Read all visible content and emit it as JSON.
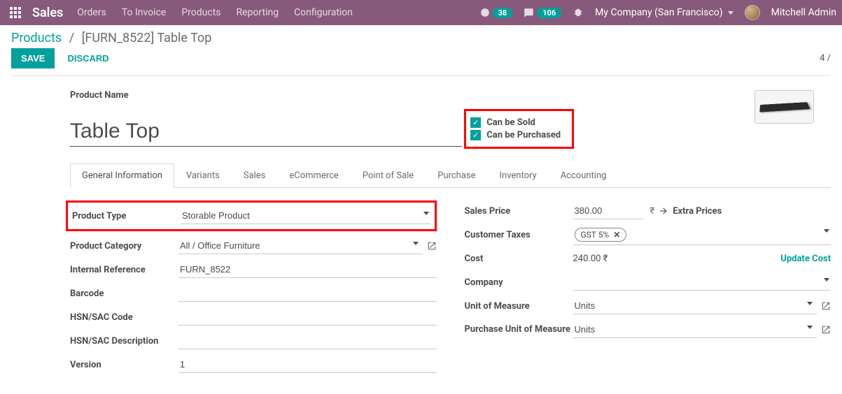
{
  "navbar": {
    "brand": "Sales",
    "menu": [
      "Orders",
      "To Invoice",
      "Products",
      "Reporting",
      "Configuration"
    ],
    "activity_count": "38",
    "message_count": "106",
    "company": "My Company (San Francisco)",
    "user": "Mitchell Admin"
  },
  "breadcrumb": {
    "root": "Products",
    "current": "[FURN_8522] Table Top"
  },
  "actions": {
    "save": "SAVE",
    "discard": "DISCARD",
    "pager": "4 /"
  },
  "product": {
    "name_label": "Product Name",
    "name": "Table Top",
    "can_be_sold": "Can be Sold",
    "can_be_purchased": "Can be Purchased"
  },
  "tabs": [
    "General Information",
    "Variants",
    "Sales",
    "eCommerce",
    "Point of Sale",
    "Purchase",
    "Inventory",
    "Accounting"
  ],
  "left_fields": {
    "product_type": {
      "label": "Product Type",
      "value": "Storable Product"
    },
    "category": {
      "label": "Product Category",
      "value": "All / Office Furniture"
    },
    "internal_ref": {
      "label": "Internal Reference",
      "value": "FURN_8522"
    },
    "barcode": {
      "label": "Barcode",
      "value": ""
    },
    "hsn_code": {
      "label": "HSN/SAC Code",
      "value": ""
    },
    "hsn_desc": {
      "label": "HSN/SAC Description",
      "value": ""
    },
    "version": {
      "label": "Version",
      "value": "1"
    }
  },
  "right_fields": {
    "sales_price": {
      "label": "Sales Price",
      "value": "380.00",
      "currency": "₹",
      "extra": "Extra Prices"
    },
    "customer_taxes": {
      "label": "Customer Taxes",
      "tag": "GST 5%"
    },
    "cost": {
      "label": "Cost",
      "value": "240.00 ₹",
      "update": "Update Cost"
    },
    "company": {
      "label": "Company",
      "value": ""
    },
    "uom": {
      "label": "Unit of Measure",
      "value": "Units"
    },
    "purchase_uom": {
      "label": "Purchase Unit of Measure",
      "value": "Units"
    }
  }
}
